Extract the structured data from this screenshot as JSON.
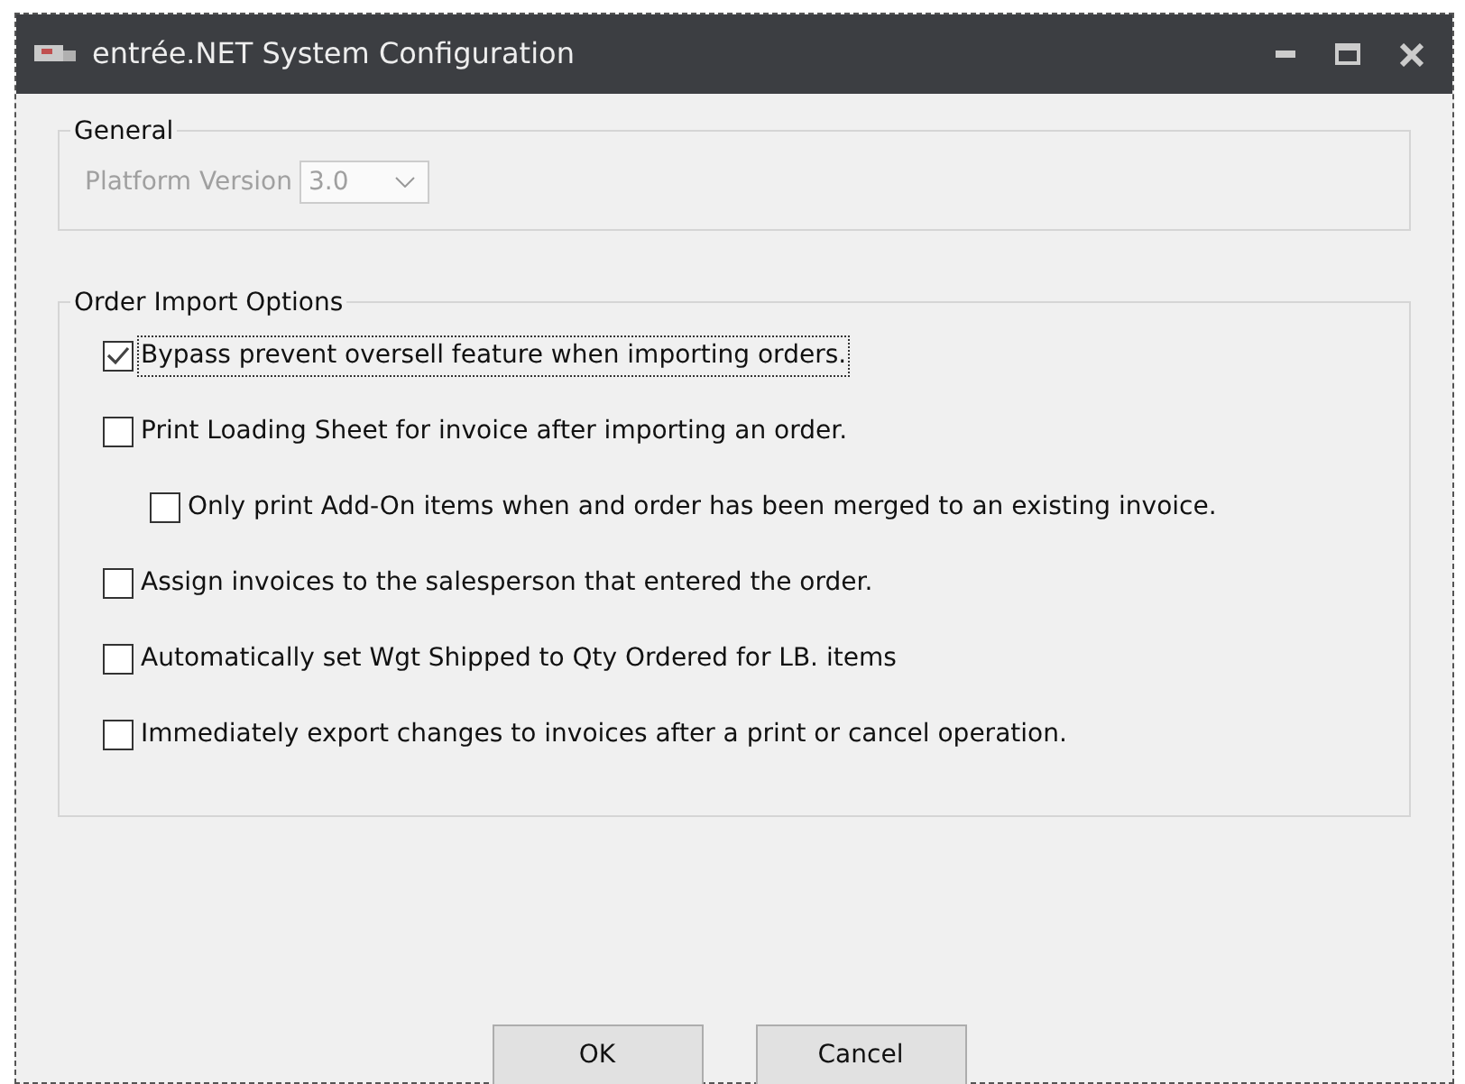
{
  "window": {
    "title": "entrée.NET System Configuration"
  },
  "general": {
    "title": "General",
    "platform_version": {
      "label": "Platform Version",
      "value": "3.0",
      "disabled": true
    }
  },
  "order_import_options": {
    "title": "Order Import Options",
    "options": [
      {
        "label": "Bypass prevent oversell feature when importing orders.",
        "checked": true,
        "focused": true
      },
      {
        "label": "Print Loading Sheet for invoice after importing an order.",
        "checked": false,
        "focused": false,
        "children": [
          {
            "label": "Only print Add-On items when and order has been merged to an existing invoice.",
            "checked": false,
            "focused": false
          }
        ]
      },
      {
        "label": "Assign invoices to the salesperson that entered the order.",
        "checked": false,
        "focused": false
      },
      {
        "label": "Automatically set Wgt Shipped to Qty Ordered for LB. items",
        "checked": false,
        "focused": false
      },
      {
        "label": "Immediately export changes to invoices after a print or cancel operation.",
        "checked": false,
        "focused": false
      }
    ]
  },
  "buttons": [
    "OK",
    "Cancel"
  ]
}
